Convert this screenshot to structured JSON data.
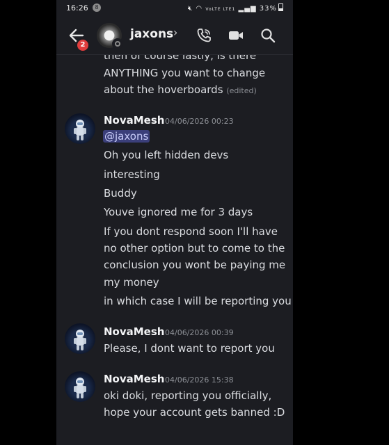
{
  "status_bar": {
    "time": "16:26",
    "notification_count": "8",
    "signal_text": "VoLTE LTE1",
    "battery": "33%"
  },
  "header": {
    "unread_badge": "2",
    "title": "jaxons",
    "chevron": "›"
  },
  "messages": {
    "previous": {
      "lines": [
        "then of course lastly, is there",
        "ANYTHING you want to change",
        "about the hoverboards"
      ],
      "edited": "(edited)"
    },
    "groups": [
      {
        "author": "NovaMesh",
        "timestamp": "04/06/2026 00:23",
        "mention": "@jaxons",
        "lines": [
          "Oh you left hidden devs",
          "interesting",
          "Buddy",
          "Youve ignored me for 3 days",
          "If you dont respond soon I'll have",
          "no other option but to come to the",
          "conclusion you wont be paying me",
          "my money",
          "in which case I will be reporting you"
        ]
      },
      {
        "author": "NovaMesh",
        "timestamp": "04/06/2026 00:39",
        "lines": [
          "Please, I dont want to report you"
        ]
      },
      {
        "author": "NovaMesh",
        "timestamp": "04/06/2026 15:38",
        "lines": [
          "oki doki, reporting you officially,",
          "hope your account gets banned :D"
        ]
      }
    ]
  },
  "icons": {
    "back": "arrow-left-icon",
    "call": "phone-icon",
    "video": "video-camera-icon",
    "search": "search-icon"
  },
  "colors": {
    "background": "#1c1d22",
    "mention_bg": "#3b3f7a",
    "badge": "#e23d3d"
  }
}
